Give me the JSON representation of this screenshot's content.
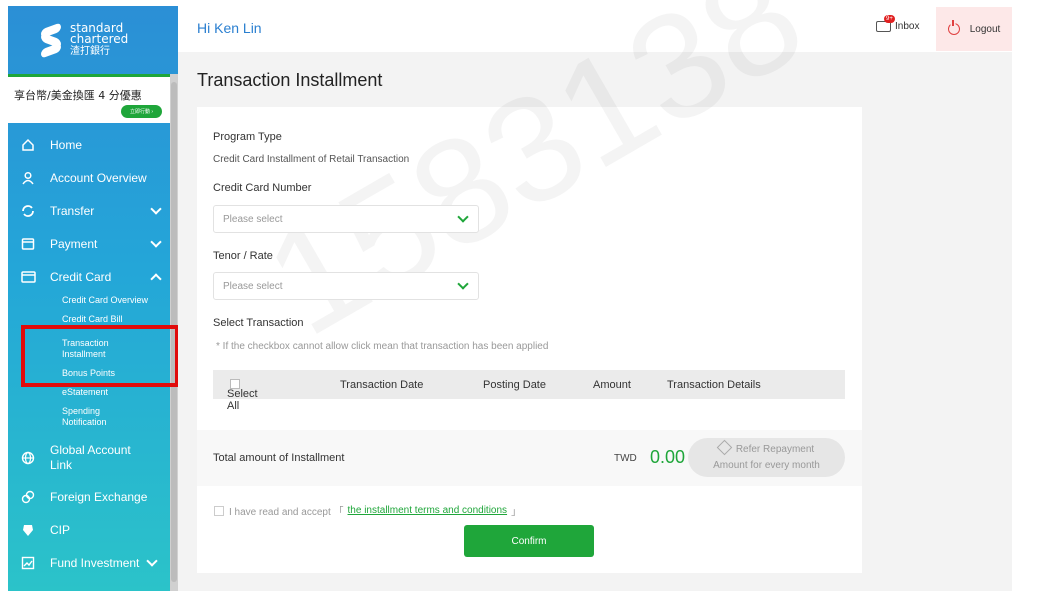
{
  "brand": {
    "line1": "standard",
    "line2": "chartered",
    "line3": "渣打銀行"
  },
  "promo": {
    "text": "享台幣/美金換匯 4 分優惠",
    "button": "立即行動 ›"
  },
  "sidebar": {
    "items": [
      {
        "label": "Home",
        "icon": "home-icon"
      },
      {
        "label": "Account Overview",
        "icon": "person-icon"
      },
      {
        "label": "Transfer",
        "icon": "transfer-icon"
      },
      {
        "label": "Payment",
        "icon": "payment-icon"
      },
      {
        "label": "Credit Card",
        "icon": "credit-card-icon"
      }
    ],
    "credit_sub": [
      "Credit Card Overview",
      "Credit Card Bill Installment",
      "Transaction Installment",
      "Bonus Points",
      "eStatement",
      "Spending Notification"
    ],
    "bottom_items": [
      {
        "label": "Global Account Link",
        "icon": "globe-icon"
      },
      {
        "label": "Foreign Exchange",
        "icon": "exchange-icon"
      },
      {
        "label": "CIP",
        "icon": "cip-icon"
      },
      {
        "label": "Fund Investment",
        "icon": "fund-icon"
      }
    ]
  },
  "header": {
    "greeting": "Hi Ken Lin",
    "inbox": "Inbox",
    "inbox_badge": "9+",
    "logout": "Logout"
  },
  "page": {
    "title": "Transaction Installment",
    "watermark": "1583138",
    "program_type_label": "Program Type",
    "program_type_value": "Credit Card Installment of Retail Transaction",
    "card_number_label": "Credit Card Number",
    "card_number_placeholder": "Please select",
    "tenor_label": "Tenor / Rate",
    "tenor_placeholder": "Please select",
    "select_transaction_label": "Select Transaction",
    "note": "* If the checkbox cannot allow click mean that transaction has been applied",
    "table_headers": {
      "select_all": "Select All",
      "transaction_date": "Transaction Date",
      "posting_date": "Posting Date",
      "amount": "Amount",
      "details": "Transaction Details"
    },
    "total_label": "Total amount of Installment",
    "currency": "TWD",
    "total_amount": "0.00",
    "refer_line1": "Refer Repayment",
    "refer_line2": "Amount for every month",
    "terms_prefix": "I have read and accept 「",
    "terms_link": "the installment terms and conditions",
    "terms_suffix": "」",
    "confirm": "Confirm"
  },
  "colors": {
    "accent_green": "#1fa63a",
    "sidebar_blue": "#2b8fd6",
    "sidebar_teal": "#2bc3c9",
    "highlight_red": "#e10b0b"
  }
}
